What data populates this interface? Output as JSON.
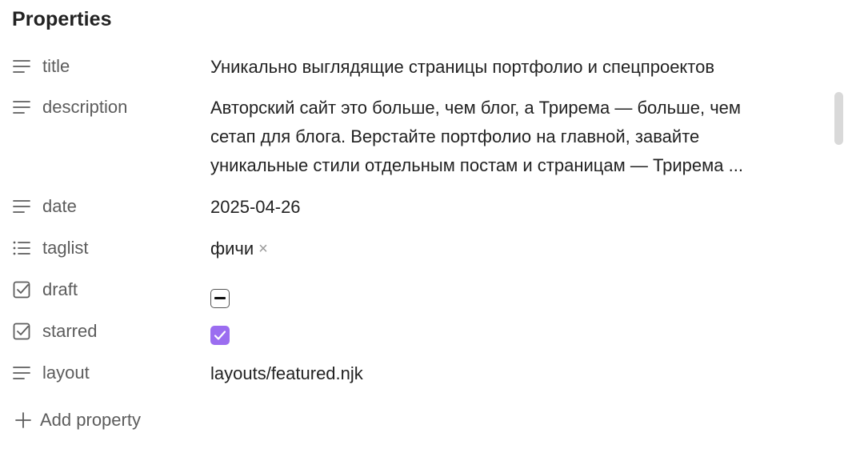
{
  "panel": {
    "heading": "Properties",
    "accent_color": "#9b6df0"
  },
  "properties": [
    {
      "key": "title",
      "icon": "text-lines-icon",
      "value": "Уникально выглядящие страницы портфолио и спецпроектов"
    },
    {
      "key": "description",
      "icon": "text-lines-icon",
      "value": "Авторский сайт это больше, чем блог, а Трирема — больше, чем сетап для блога. Верстайте портфолио на главной, завайте уникальные стили отдельным постам и страницам — Трирема ..."
    },
    {
      "key": "date",
      "icon": "text-lines-icon",
      "value": "2025-04-26"
    },
    {
      "key": "taglist",
      "icon": "list-icon",
      "tags": [
        "фичи"
      ],
      "remove_glyph": "×"
    },
    {
      "key": "draft",
      "icon": "checkbox-icon",
      "state": "indeterminate"
    },
    {
      "key": "starred",
      "icon": "checkbox-icon",
      "state": "checked"
    },
    {
      "key": "layout",
      "icon": "text-lines-icon",
      "value": "layouts/featured.njk"
    }
  ],
  "add_property": {
    "label": "Add property",
    "icon": "plus-icon"
  }
}
